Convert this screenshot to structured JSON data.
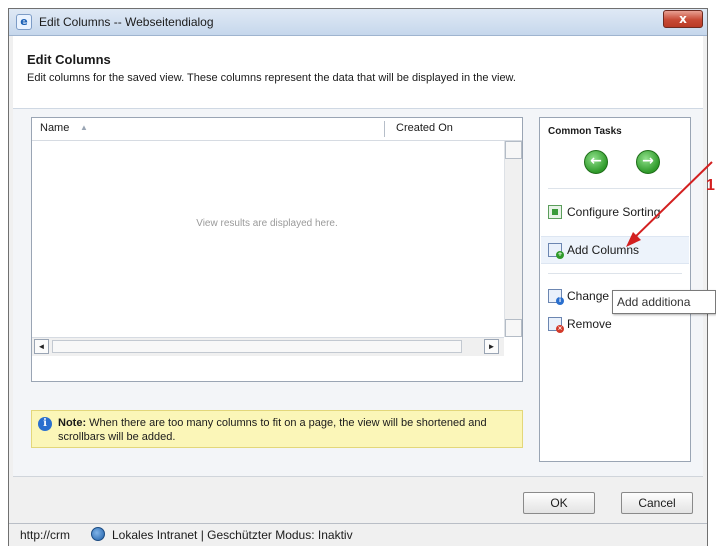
{
  "window": {
    "title": "Edit Columns -- Webseitendialog",
    "close_label": "x",
    "ie_glyph": "e"
  },
  "header": {
    "title": "Edit Columns",
    "description": "Edit columns for the saved view. These columns represent the data that will be displayed in the view."
  },
  "grid": {
    "columns": [
      "Name",
      "Created On"
    ],
    "sort_glyph": "▲",
    "empty_message": "View results are displayed here.",
    "left_arrow": "◄",
    "right_arrow": "►"
  },
  "note": {
    "label": "Note:",
    "text": " When there are too many columns to fit on a page, the view will be shortened and scrollbars will be added.",
    "icon_glyph": "i"
  },
  "tasks": {
    "title": "Common Tasks",
    "back_glyph": "←",
    "forward_glyph": "→",
    "configure_sorting": "Configure Sorting",
    "add_columns": "Add Columns",
    "change_properties": "Change P",
    "remove": "Remove"
  },
  "tooltip": {
    "text": "Add additiona"
  },
  "footer": {
    "ok_label": "OK",
    "cancel_label": "Cancel"
  },
  "status": {
    "url": "http://crm",
    "zone": "Lokales Intranet | Geschützter Modus: Inaktiv"
  },
  "annotation": {
    "number": "1",
    "color": "#d32020"
  },
  "icons": [
    "ie-icon",
    "close-icon",
    "sort-icon",
    "info-icon",
    "back-arrow-icon",
    "forward-arrow-icon",
    "configure-sorting-icon",
    "add-columns-icon",
    "change-properties-icon",
    "remove-icon",
    "globe-icon"
  ],
  "colors": {
    "note_background": "#fbf6b8",
    "nav_button_green": "#2f9a2a",
    "close_button_red": "#c74a35"
  }
}
